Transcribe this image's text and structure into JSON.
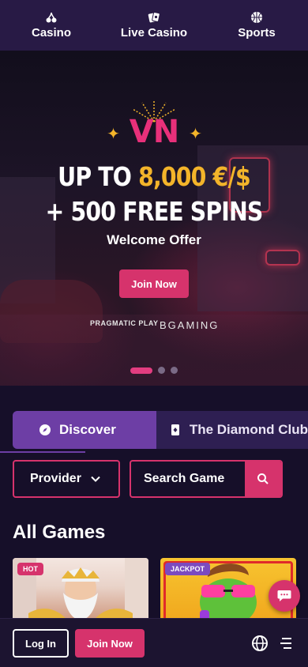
{
  "topnav": {
    "items": [
      {
        "label": "Casino",
        "icon": "cherries-icon"
      },
      {
        "label": "Live Casino",
        "icon": "cards-icon"
      },
      {
        "label": "Sports",
        "icon": "basketball-icon"
      }
    ]
  },
  "hero": {
    "logo_text": "VN",
    "line1_prefix": "UP TO ",
    "line1_amount": "8,000 €/$",
    "line2": "+ 500 FREE SPINS",
    "subtitle": "Welcome Offer",
    "cta_label": "Join Now",
    "providers": [
      "PRAGMATIC PLAY",
      "BGAMING"
    ],
    "slides_total": 3,
    "active_slide": 1,
    "accent_color": "#f3b42a"
  },
  "tabs": [
    {
      "label": "Discover",
      "icon": "compass-icon",
      "active": true
    },
    {
      "label": "The Diamond Club",
      "icon": "diamond-card-icon",
      "active": false
    }
  ],
  "filters": {
    "provider_label": "Provider",
    "search_placeholder": "Search Game"
  },
  "section": {
    "title": "All Games"
  },
  "games": [
    {
      "badge": "HOT",
      "theme": "Greek god"
    },
    {
      "badge": "JACKPOT",
      "theme": "Frog"
    }
  ],
  "bottombar": {
    "login_label": "Log In",
    "join_label": "Join Now"
  },
  "colors": {
    "brand_pink": "#d6336c",
    "nav_bg": "#281a45",
    "tab_active": "#6d3ea5",
    "page_bg": "#160f29"
  }
}
